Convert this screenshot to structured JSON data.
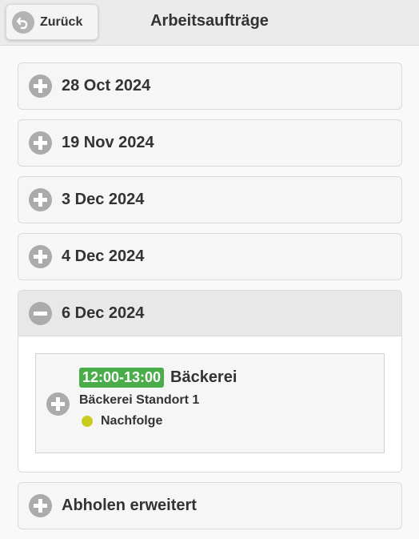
{
  "header": {
    "back_label": "Zurück",
    "title": "Arbeitsaufträge"
  },
  "groups": [
    {
      "label": "28 Oct 2024",
      "expanded": false
    },
    {
      "label": "19 Nov 2024",
      "expanded": false
    },
    {
      "label": "3 Dec 2024",
      "expanded": false
    },
    {
      "label": "4 Dec 2024",
      "expanded": false
    },
    {
      "label": "6 Dec 2024",
      "expanded": true
    },
    {
      "label": "Abholen erweitert",
      "expanded": false
    }
  ],
  "job": {
    "time": "12:00-13:00",
    "title": "Bäckerei",
    "location": "Bäckerei Standort 1",
    "status": "Nachfolge",
    "time_color": "#4aad4a",
    "status_color": "#c8cc1e"
  }
}
